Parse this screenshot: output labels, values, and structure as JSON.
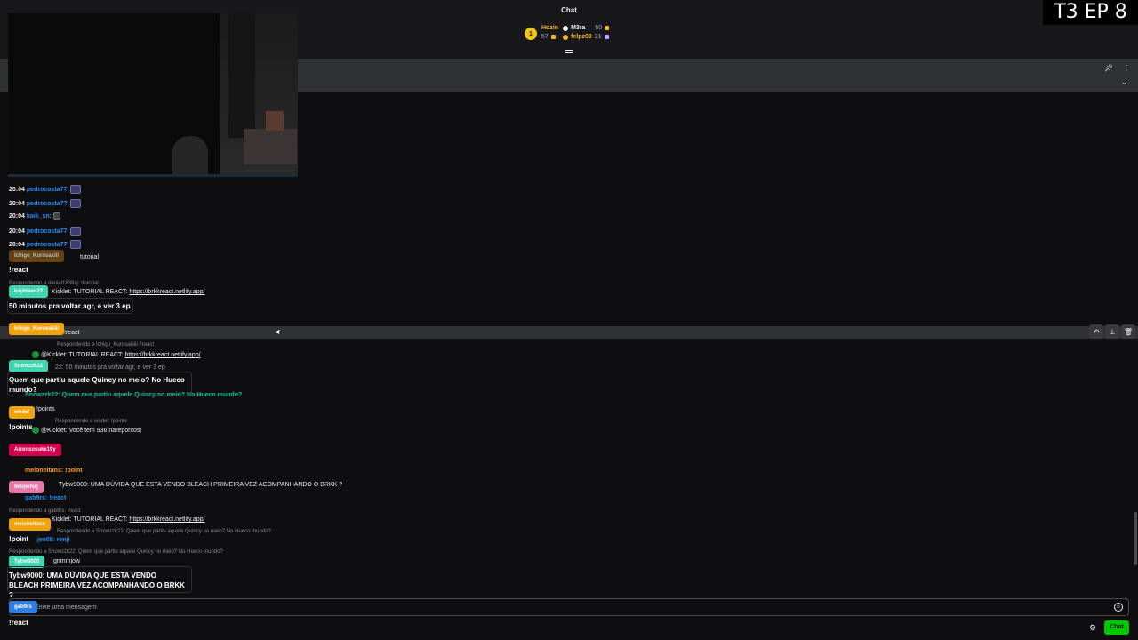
{
  "header": {
    "title": "Chat",
    "overlay": "T3 EP 8"
  },
  "leaderboard": {
    "first": {
      "rank": "1",
      "name": "Hdzin",
      "points": "57"
    },
    "second": {
      "name": "M3ra",
      "points": "50"
    },
    "third": {
      "name": "felpz09",
      "points": "21"
    }
  },
  "messages": [
    {
      "ts": "20:04",
      "user": "pedrocosta77",
      "text": ":"
    },
    {
      "ts": "20:04",
      "user": "pedrocosta77",
      "text": ":"
    },
    {
      "ts": "20:04",
      "user": "kaik_sn",
      "text": ":"
    },
    {
      "ts": "20:04",
      "user": "pedrocosta77",
      "text": ":"
    },
    {
      "ts": "20:04",
      "user": "pedrocosta77",
      "text": ":"
    }
  ],
  "feed": {
    "tutorial": "tutorial",
    "reply_daniel": "Respondendo a daniel1838sj: !tutorial",
    "kicklet_label": "Kicklet:",
    "tutorial_react": "TUTORIAL REACT:",
    "link": "https://brkkreact.netlify.app/",
    "reply_ichigo": "Respondendo a Ichigo_Kurosakiiii: !react",
    "react_cmd": "!react",
    "kicklet_tutorial": "@Kicklet: TUTORIAL REACT:",
    "snow_line_a": "22: 50 minutos pra voltar agr, e ver 3 ep",
    "snow_line_b": "Snowzzk22: Quem que partiu aquele Quincy no meio? No Hueco mundo?",
    "points_cmd": "!points",
    "reply_wndel": "Respondendo a wndel: !points",
    "kicklet_points": "@Kicklet: Você tem 936 narepontos!",
    "meloneitans": "meloneitans: !point",
    "tybw_question": "Tybw9000: UMA DÚVIDA QUE ESTA VENDO BLEACH PRIMEIRA VEZ ACOMPANHANDO O BRKK ?",
    "reply_gab": "Respondendo a gab9rs: !react",
    "gab_react": "gab9rs: !react",
    "reply_snow_1": "Respondendo a Snowzzk22: Quem que partiu aquele Quincy no meio? No Hueco mundo?",
    "renji": "jes09: renji",
    "reply_snow_2": "Respondendo a Snowzzk22: Quem que partiu aquele Quincy no meio? No Hueco mundo?",
    "grimmjow": "grimmjow"
  },
  "tags": {
    "ichigo_dim": "Ichigo_Kurosakiii",
    "kayh": "kayhlaan22",
    "ichigo": "Ichigo_Kurosakiii",
    "snow": "Snowzzk22",
    "wndel": "wndel",
    "aizen": "Aizensosuke19y",
    "felipe": "feilipefsrj",
    "melon": "meloneitans",
    "tybw": "Tybw9000",
    "gab": "gab9rs"
  },
  "bubbles": {
    "react1": "!react",
    "fifty": "50 minutos pra voltar agr, e ver 3 ep",
    "quincy": "Quem que partiu aquele Quincy no meio? No Hueco mundo?",
    "points": "!points",
    "point": "!point",
    "tybw": "Tybw9000: UMA DÚVIDA QUE ESTA VENDO BLEACH PRIMEIRA VEZ ACOMPANHANDO O BRKK ?",
    "react2": "!react"
  },
  "input": {
    "placeholder": "Envie uma mensagem"
  },
  "actions": {
    "chat_button": "Chat"
  },
  "colors": {
    "accent": "#00c800",
    "background": "#0e0e10"
  },
  "icons": [
    "pin-icon",
    "more-icon",
    "chevron-down-icon",
    "reply-icon",
    "delete-icon",
    "emote-icon",
    "settings-icon",
    "expand-icon"
  ]
}
